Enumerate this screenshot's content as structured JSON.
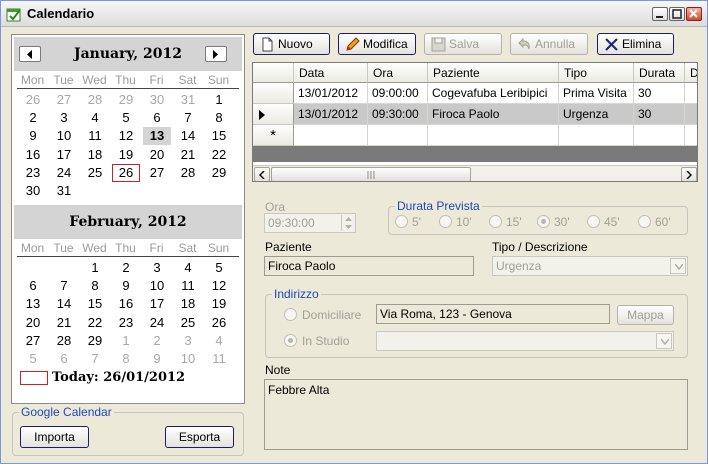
{
  "window": {
    "title": "Calendario"
  },
  "calendar": {
    "dow": [
      "Mon",
      "Tue",
      "Wed",
      "Thu",
      "Fri",
      "Sat",
      "Sun"
    ],
    "months": [
      {
        "title": "January, 2012",
        "weeks": [
          [
            {
              "d": "26",
              "g": 1
            },
            {
              "d": "27",
              "g": 1
            },
            {
              "d": "28",
              "g": 1
            },
            {
              "d": "29",
              "g": 1
            },
            {
              "d": "30",
              "g": 1
            },
            {
              "d": "31",
              "g": 1
            },
            {
              "d": "1"
            }
          ],
          [
            {
              "d": "2"
            },
            {
              "d": "3"
            },
            {
              "d": "4"
            },
            {
              "d": "5"
            },
            {
              "d": "6"
            },
            {
              "d": "7"
            },
            {
              "d": "8"
            }
          ],
          [
            {
              "d": "9"
            },
            {
              "d": "10"
            },
            {
              "d": "11"
            },
            {
              "d": "12"
            },
            {
              "d": "13",
              "b": 1
            },
            {
              "d": "14"
            },
            {
              "d": "15"
            }
          ],
          [
            {
              "d": "16"
            },
            {
              "d": "17"
            },
            {
              "d": "18"
            },
            {
              "d": "19"
            },
            {
              "d": "20"
            },
            {
              "d": "21"
            },
            {
              "d": "22"
            }
          ],
          [
            {
              "d": "23"
            },
            {
              "d": "24"
            },
            {
              "d": "25"
            },
            {
              "d": "26",
              "t": 1
            },
            {
              "d": "27"
            },
            {
              "d": "28"
            },
            {
              "d": "29"
            }
          ],
          [
            {
              "d": "30"
            },
            {
              "d": "31"
            }
          ]
        ]
      },
      {
        "title": "February, 2012",
        "weeks": [
          [
            {
              "d": ""
            },
            {
              "d": ""
            },
            {
              "d": "1"
            },
            {
              "d": "2"
            },
            {
              "d": "3"
            },
            {
              "d": "4"
            },
            {
              "d": "5"
            }
          ],
          [
            {
              "d": "6"
            },
            {
              "d": "7"
            },
            {
              "d": "8"
            },
            {
              "d": "9"
            },
            {
              "d": "10"
            },
            {
              "d": "11"
            },
            {
              "d": "12"
            }
          ],
          [
            {
              "d": "13"
            },
            {
              "d": "14"
            },
            {
              "d": "15"
            },
            {
              "d": "16"
            },
            {
              "d": "17"
            },
            {
              "d": "18"
            },
            {
              "d": "19"
            }
          ],
          [
            {
              "d": "20"
            },
            {
              "d": "21"
            },
            {
              "d": "22"
            },
            {
              "d": "23"
            },
            {
              "d": "24"
            },
            {
              "d": "25"
            },
            {
              "d": "26"
            }
          ],
          [
            {
              "d": "27"
            },
            {
              "d": "28"
            },
            {
              "d": "29"
            },
            {
              "d": "1",
              "g": 1
            },
            {
              "d": "2",
              "g": 1
            },
            {
              "d": "3",
              "g": 1
            },
            {
              "d": "4",
              "g": 1
            }
          ],
          [
            {
              "d": "5",
              "g": 1
            },
            {
              "d": "6",
              "g": 1
            },
            {
              "d": "7",
              "g": 1
            },
            {
              "d": "8",
              "g": 1
            },
            {
              "d": "9",
              "g": 1
            },
            {
              "d": "10",
              "g": 1
            },
            {
              "d": "11",
              "g": 1
            }
          ]
        ]
      }
    ],
    "today_label": "Today: 26/01/2012"
  },
  "google": {
    "legend": "Google Calendar",
    "import_label": "Importa",
    "export_label": "Esporta"
  },
  "toolbar": {
    "new_label": "Nuovo",
    "edit_label": "Modifica",
    "save_label": "Salva",
    "cancel_label": "Annulla",
    "delete_label": "Elimina"
  },
  "grid": {
    "columns": [
      "Data",
      "Ora",
      "Paziente",
      "Tipo",
      "Durata",
      "D"
    ],
    "rows": [
      [
        "13/01/2012",
        "09:00:00",
        "Cogevafuba Leribipici",
        "Prima Visita",
        "30"
      ],
      [
        "13/01/2012",
        "09:30:00",
        "Firoca Paolo",
        "Urgenza",
        "30"
      ]
    ],
    "new_row_marker": "*"
  },
  "detail": {
    "ora_label": "Ora",
    "ora_value": "09:30:00",
    "durata_legend": "Durata Prevista",
    "durata_options": [
      "5'",
      "10'",
      "15'",
      "30'",
      "45'",
      "60'"
    ],
    "paziente_label": "Paziente",
    "paziente_value": "Firoca Paolo",
    "tipo_label": "Tipo / Descrizione",
    "tipo_value": "Urgenza",
    "indirizzo_legend": "Indirizzo",
    "domiciliare_label": "Domiciliare",
    "domiciliare_value": "Via Roma, 123 - Genova",
    "mappa_label": "Mappa",
    "studio_label": "In Studio",
    "note_label": "Note",
    "note_value": "Febbre Alta"
  }
}
